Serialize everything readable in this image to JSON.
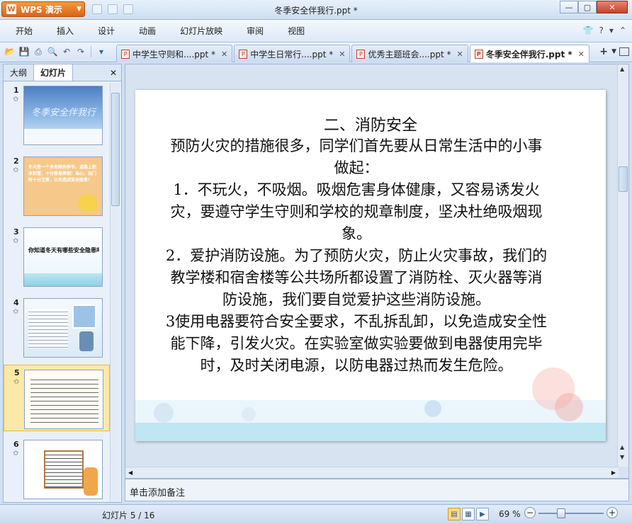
{
  "app": {
    "name": "WPS 演示",
    "window_title": "冬季安全伴我行.ppt *"
  },
  "menu": [
    "开始",
    "插入",
    "设计",
    "动画",
    "幻灯片放映",
    "审阅",
    "视图"
  ],
  "doc_tabs": [
    {
      "label": "中学生守则和....ppt *",
      "active": false
    },
    {
      "label": "中学生日常行....ppt *",
      "active": false
    },
    {
      "label": "优秀主题班会....ppt *",
      "active": false
    },
    {
      "label": "冬季安全伴我行.ppt *",
      "active": true
    }
  ],
  "left_panel": {
    "tabs": [
      "大纲",
      "幻灯片"
    ],
    "active_tab": "幻灯片",
    "close": "✕",
    "thumbnails": [
      {
        "number": "1",
        "caption": "冬季安全伴我行"
      },
      {
        "number": "2",
        "caption": "冬天是一个多危险的季节，道路上积冰积雪，十分容易摔倒！当心，出门时十分注意，以免造成安全隐患！"
      },
      {
        "number": "3",
        "caption": "你知道冬天有哪些安全隐患吗？"
      },
      {
        "number": "4",
        "caption": ""
      },
      {
        "number": "5",
        "caption": ""
      },
      {
        "number": "6",
        "caption": ""
      }
    ],
    "selected_index": 4
  },
  "slide": {
    "title": "二、消防安全",
    "lines": [
      "预防火灾的措施很多，同学们首先要从日常生活中的小事做起：",
      "1．不玩火，不吸烟。吸烟危害身体健康，又容易诱发火灾，要遵守学生守则和学校的规章制度，坚决杜绝吸烟现象。",
      "2．爱护消防设施。为了预防火灾，防止火灾事故，我们的教学楼和宿舍楼等公共场所都设置了消防栓、灭火器等消防设施，我们要自觉爱护这些消防设施。",
      "3使用电器要符合安全要求，不乱拆乱卸，以免造成安全性能下降，引发火灾。在实验室做实验要做到电器使用完毕时，及时关闭电源，以防电器过热而发生危险。"
    ]
  },
  "notes_placeholder": "单击添加备注",
  "status": {
    "slide_info": "幻灯片 5 / 16",
    "zoom": "69 %",
    "zoom_fraction": 0.35
  },
  "colors": {
    "wps_orange": "#e8792a",
    "selected_thumb": "#fbe9a7",
    "close_red": "#c7412a"
  }
}
